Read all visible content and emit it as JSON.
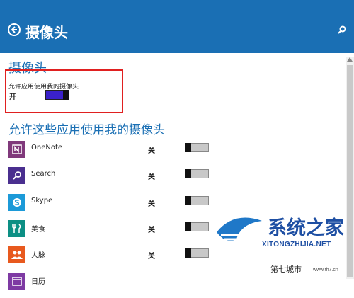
{
  "header": {
    "title": "摄像头"
  },
  "section": {
    "title": "摄像头"
  },
  "master": {
    "label": "允许应用使用我的摄像头",
    "state": "开"
  },
  "apps_title": "允许这些应用使用我的摄像头",
  "apps": [
    {
      "name": "OneNote",
      "state": "关",
      "icon": "onenote-icon",
      "color": "#80397b",
      "glyph": "N"
    },
    {
      "name": "Search",
      "state": "关",
      "icon": "search-app-icon",
      "color": "#4a2f8f",
      "glyph": "⌕"
    },
    {
      "name": "Skype",
      "state": "关",
      "icon": "skype-icon",
      "color": "#1c9ad8",
      "glyph": "S"
    },
    {
      "name": "美食",
      "state": "关",
      "icon": "food-icon",
      "color": "#0c8f84",
      "glyph": "🍴"
    },
    {
      "name": "人脉",
      "state": "关",
      "icon": "people-icon",
      "color": "#e8591e",
      "glyph": "👥"
    },
    {
      "name": "日历",
      "state": "",
      "icon": "calendar-icon",
      "color": "#7e3aa3",
      "glyph": "▦"
    }
  ],
  "watermark": {
    "brand": "系统之家",
    "sub": "XITONGZHIJIA.NET",
    "footer": "第七城市",
    "url": "www.th7.cn"
  },
  "colors": {
    "accent": "#1a6fb4",
    "highlight": "#e02020",
    "toggle_on": "#3a21c9"
  }
}
